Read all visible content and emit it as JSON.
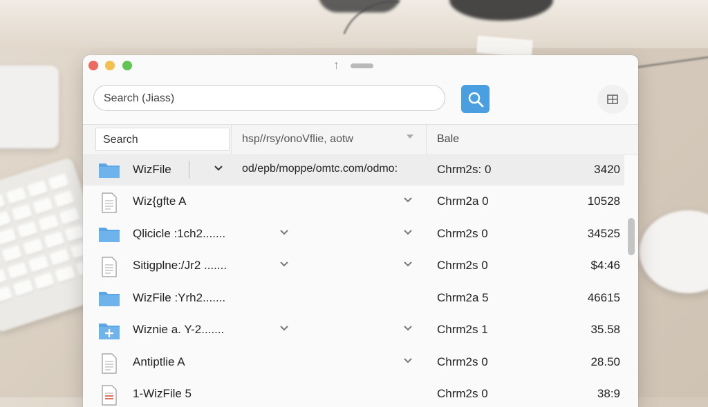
{
  "window": {
    "title": ""
  },
  "search": {
    "label": "Search (Jiass)"
  },
  "header": {
    "search_label": "Search",
    "path": "hsp//rsy/onoVflie, aotw",
    "column3": "Bale"
  },
  "rows": [
    {
      "icon": "folder-icon",
      "name": "WizFile",
      "path": "od/epb/moppe/omtc.com/odmo:",
      "category": "Chrm2s: 0",
      "size": "3420",
      "selected": true
    },
    {
      "icon": "document-icon",
      "name": "Wiz{gfte A",
      "path": "",
      "category": "Chrm2a 0",
      "size": "10528"
    },
    {
      "icon": "folder-icon",
      "name": "Qlicicle :1ch2.......",
      "path": "",
      "category": "Chrm2s 0",
      "size": "34525"
    },
    {
      "icon": "document-icon",
      "name": "Sitigplne:/Jr2 .......",
      "path": "",
      "category": "Chrm2s 0",
      "size": "$4:46"
    },
    {
      "icon": "folder-icon",
      "name": "WizFile :Yrh2.......",
      "path": "",
      "category": "Chrm2a 5",
      "size": "46615"
    },
    {
      "icon": "folder-plus-icon",
      "name": "Wiznie a. Y-2.......",
      "path": "",
      "category": "Chrm2s 1",
      "size": "35.58"
    },
    {
      "icon": "document-icon",
      "name": "Antiptlie A",
      "path": "",
      "category": "Chrm2s 0",
      "size": "28.50"
    },
    {
      "icon": "pdf-document-icon",
      "name": "1-WizFile 5",
      "path": "",
      "category": "Chrm2s 0",
      "size": "38:9"
    }
  ],
  "colors": {
    "accent": "#4a9fe0",
    "folder": "#5aa5e6",
    "selected_row": "#ededed"
  }
}
